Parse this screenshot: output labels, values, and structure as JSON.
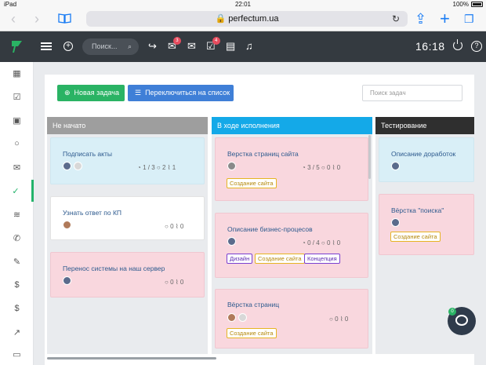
{
  "ios_status": {
    "device": "iPad",
    "time": "22:01",
    "battery": "100%"
  },
  "browser": {
    "url": "perfectum.ua"
  },
  "appbar": {
    "search_placeholder": "Поиск...",
    "chat_badge": "3",
    "tasks_badge": "4",
    "clock": "16:18",
    "help": "?"
  },
  "toolbar": {
    "new_task": "Новая задача",
    "switch_list": "Переключиться на список",
    "search_placeholder": "Поиск задач"
  },
  "columns": [
    {
      "title": "Не начато",
      "color": "#9e9e9e"
    },
    {
      "title": "В ходе исполнения",
      "color": "#14a9e8"
    },
    {
      "title": "Тестирование",
      "color": "#2f2f2f"
    }
  ],
  "cards": {
    "c1": {
      "title": "Подписать акты",
      "subtasks": "1 / 3",
      "comments": "2",
      "files": "1"
    },
    "c2": {
      "title": "Узнать ответ по КП",
      "comments": "0",
      "files": "0"
    },
    "c3": {
      "title": "Перенос системы на наш сервер",
      "comments": "0",
      "files": "0"
    },
    "c4": {
      "title": "Верстка страниц сайта",
      "subtasks": "3 / 5",
      "comments": "0",
      "files": "0",
      "tag1": "Создание сайта"
    },
    "c5": {
      "title": "Описание бизнес-процесов",
      "subtasks": "0 / 4",
      "comments": "0",
      "files": "0",
      "tag1": "Дизайн",
      "tag2": "Создание сайта",
      "tag3": "Концепция"
    },
    "c6": {
      "title": "Вёрстка страниц",
      "comments": "0",
      "files": "0",
      "tag1": "Создание сайта"
    },
    "c7": {
      "title": "Описание доработок"
    },
    "c8": {
      "title": "Вёрстка \"поиска\"",
      "tag1": "Создание сайта"
    }
  },
  "chat_widget": {
    "badge": "0"
  },
  "colors": {
    "green": "#2ab364",
    "blue": "#3f7fd7",
    "dark": "#343a40",
    "pink": "#f9d7de",
    "light_blue": "#d9eff7"
  }
}
